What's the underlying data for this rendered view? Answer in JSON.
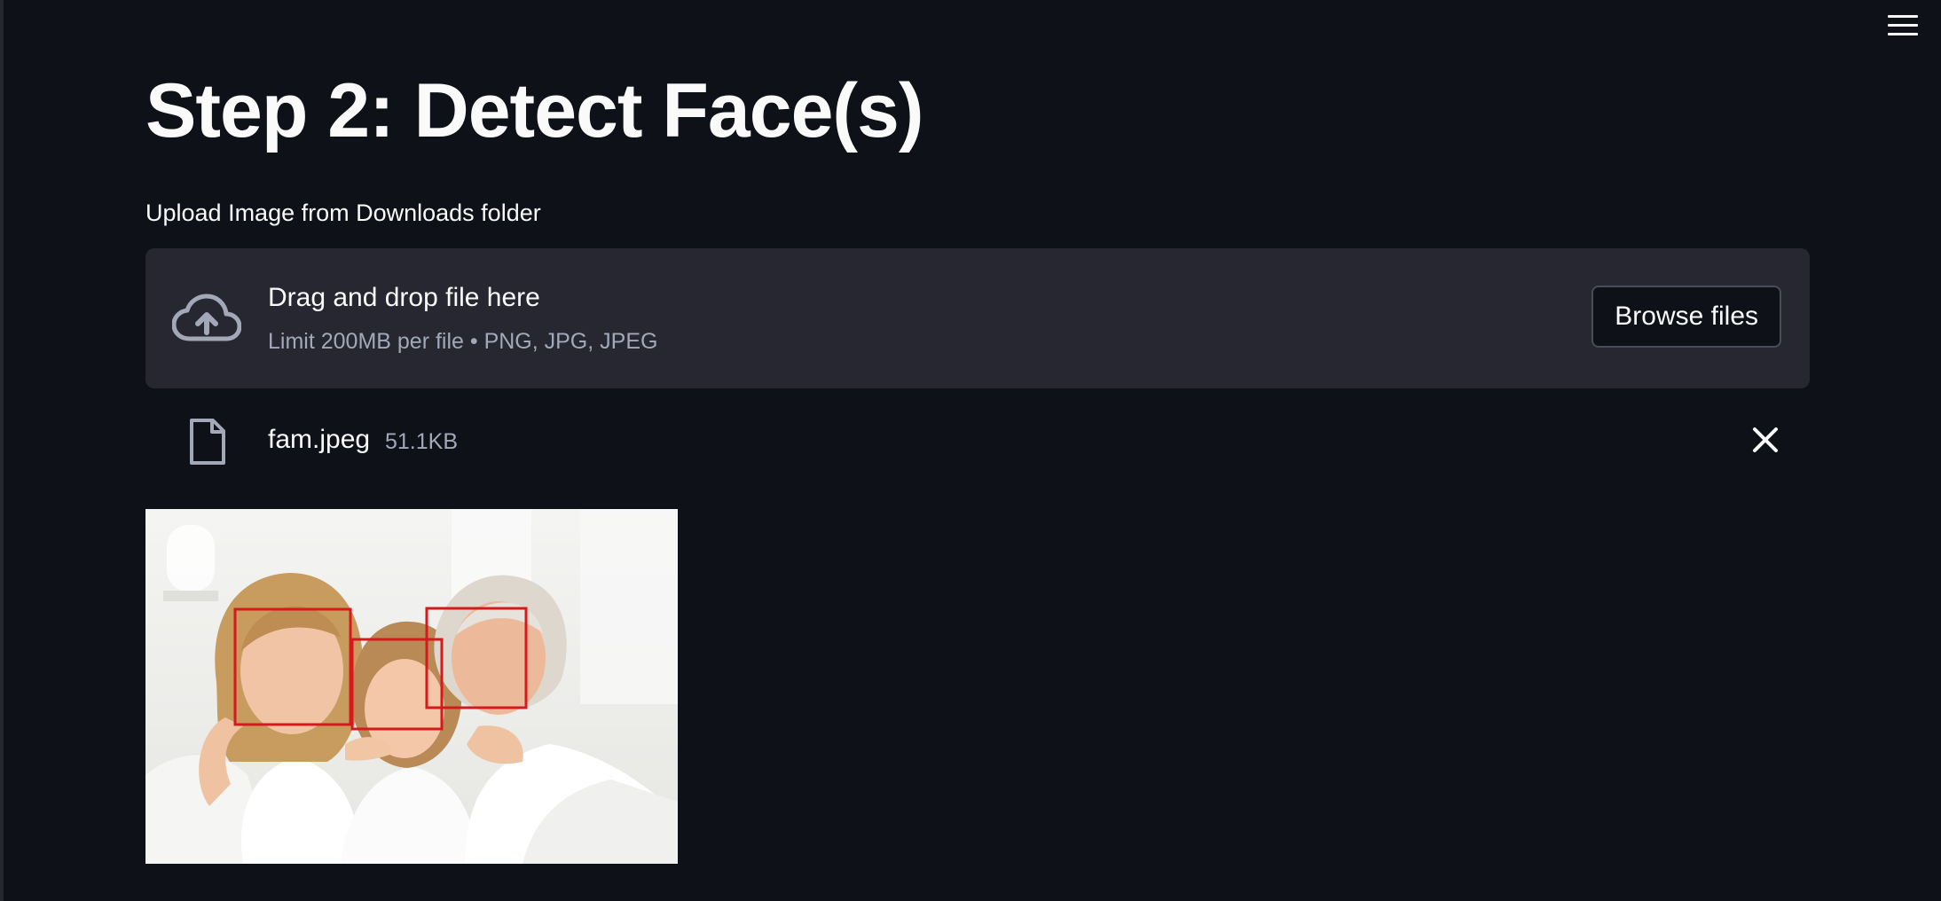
{
  "page": {
    "title": "Step 2: Detect Face(s)"
  },
  "uploader": {
    "label": "Upload Image from Downloads folder",
    "drop_text": "Drag and drop file here",
    "limit_text": "Limit 200MB per file • PNG, JPG, JPEG",
    "browse_label": "Browse files",
    "icon": "cloud-upload-icon"
  },
  "file": {
    "name": "fam.jpeg",
    "size": "51.1KB",
    "icon": "file-icon",
    "remove_icon": "close-icon"
  },
  "image": {
    "alt": "",
    "faces_detected": 3,
    "box_color": "#d7191c"
  },
  "menu": {
    "icon": "hamburger-menu-icon"
  },
  "colors": {
    "background": "#0e1117",
    "panel": "#262730",
    "text": "#fafafa",
    "muted_text": "#a3a8b8"
  }
}
